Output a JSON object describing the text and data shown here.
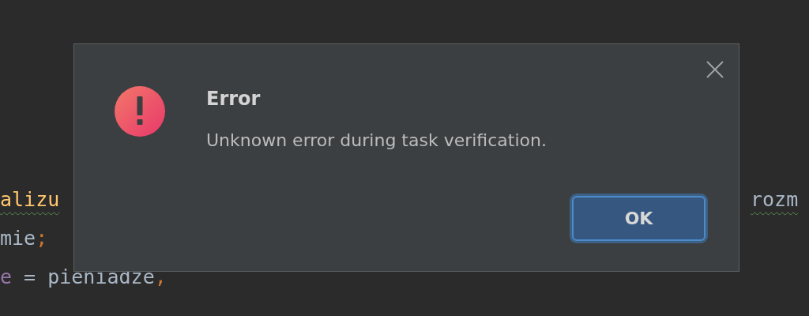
{
  "editor": {
    "lines": [
      {
        "tokens": [
          {
            "text": "alizu",
            "kind": "method"
          }
        ],
        "right": [
          {
            "text": "rozm",
            "kind": "plain"
          }
        ],
        "warning": true
      },
      {
        "tokens": [
          {
            "text": "mie",
            "kind": "plain"
          },
          {
            "text": ";",
            "kind": "punct"
          }
        ],
        "warning": false
      },
      {
        "tokens": [
          {
            "text": "e",
            "kind": "field"
          },
          {
            "text": " = pieniadze",
            "kind": "plain"
          },
          {
            "text": ",",
            "kind": "punct"
          }
        ],
        "warning": false
      }
    ]
  },
  "dialog": {
    "title": "Error",
    "message": "Unknown error during task verification.",
    "button": "OK"
  }
}
